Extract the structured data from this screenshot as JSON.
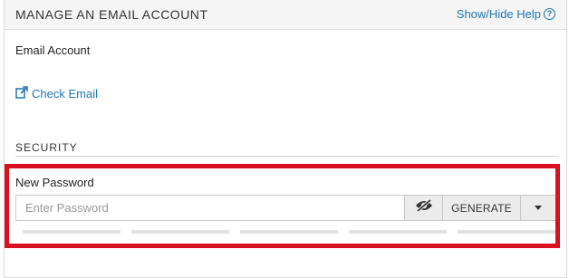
{
  "header": {
    "title": "MANAGE AN EMAIL ACCOUNT",
    "help_link": "Show/Hide Help",
    "help_icon": "?"
  },
  "email_account": {
    "label": "Email Account",
    "check_email_link": "Check Email"
  },
  "security": {
    "section_title": "SECURITY",
    "new_password_label": "New Password",
    "password_value": "",
    "password_placeholder": "Enter Password",
    "generate_label": "GENERATE",
    "strength_segments": 5,
    "strength_level": 0
  },
  "icons": {
    "help": "question-circle-icon",
    "check_email": "external-link-icon",
    "toggle_visibility": "eye-slash-icon",
    "dropdown": "caret-down-icon"
  },
  "colors": {
    "link": "#1d77b5",
    "highlight": "#d9101f",
    "header_bg": "#f5f5f5",
    "button_bg": "#ececec"
  }
}
